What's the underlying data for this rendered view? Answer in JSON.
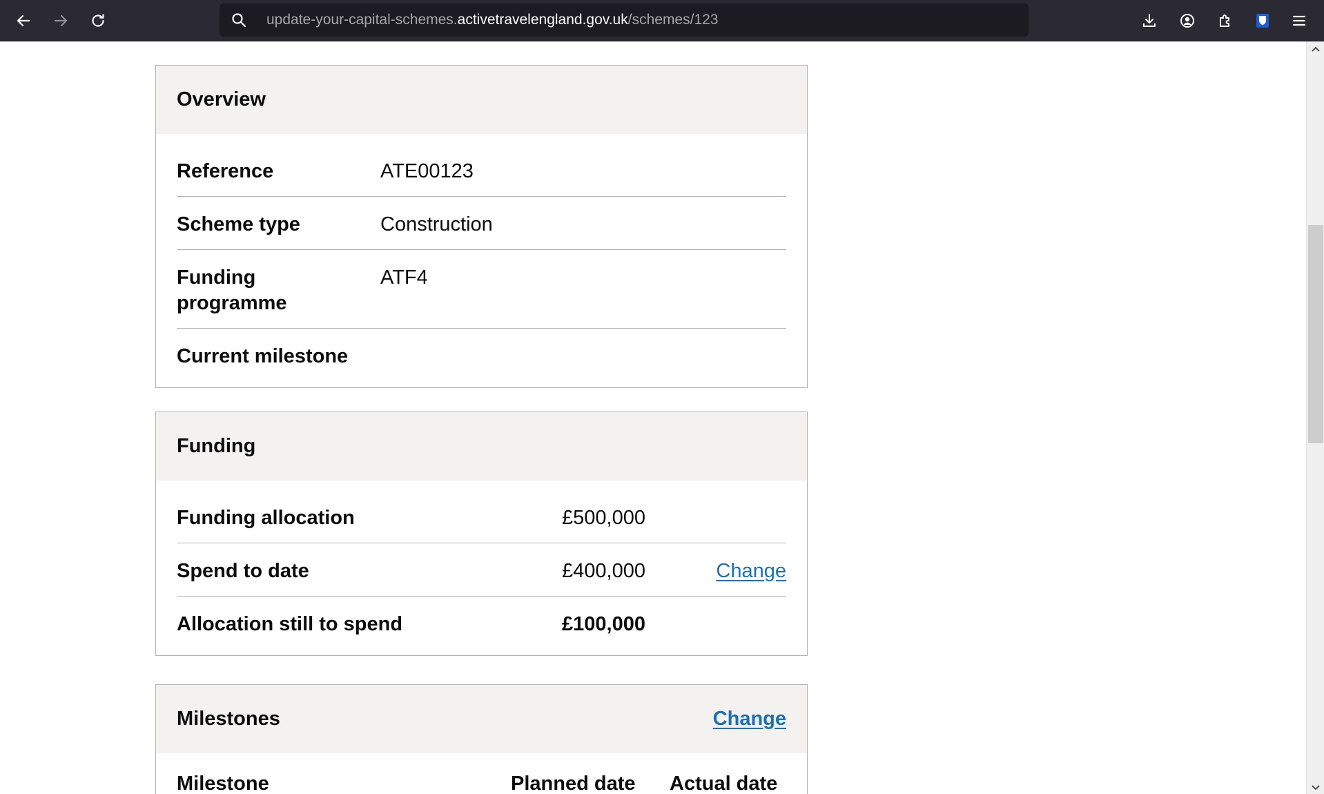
{
  "browser": {
    "url_prefix": "update-your-capital-schemes.",
    "url_host": "activetravelengland.gov.uk",
    "url_path": "/schemes/123"
  },
  "overview": {
    "title": "Overview",
    "rows": [
      {
        "key": "Reference",
        "value": "ATE00123"
      },
      {
        "key": "Scheme type",
        "value": "Construction"
      },
      {
        "key": "Funding programme",
        "value": "ATF4"
      },
      {
        "key": "Current milestone",
        "value": ""
      }
    ]
  },
  "funding": {
    "title": "Funding",
    "rows": [
      {
        "key": "Funding allocation",
        "value": "£500,000",
        "action": ""
      },
      {
        "key": "Spend to date",
        "value": "£400,000",
        "action": "Change"
      },
      {
        "key": "Allocation still to spend",
        "value": "£100,000",
        "action": ""
      }
    ]
  },
  "milestones": {
    "title": "Milestones",
    "change_label": "Change",
    "columns": [
      "Milestone",
      "Planned date",
      "Actual date"
    ]
  }
}
